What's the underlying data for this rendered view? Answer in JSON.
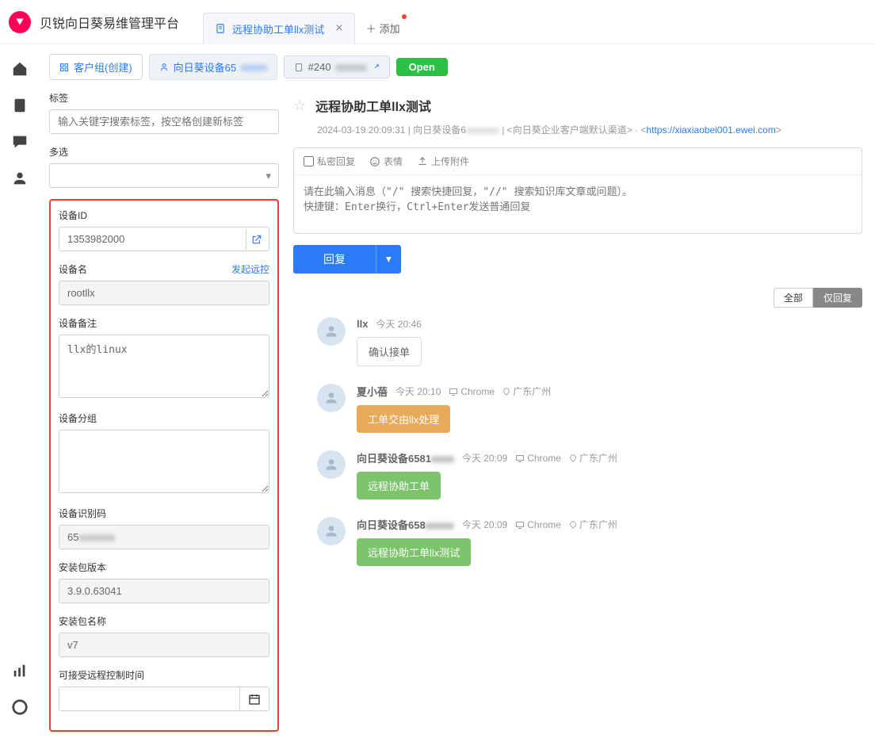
{
  "app": {
    "title": "贝锐向日葵易维管理平台"
  },
  "tabs": {
    "active": "远程协助工单llx测试",
    "add": "添加"
  },
  "breadcrumb": {
    "group": "客户组(创建)",
    "device_prefix": "向日葵设备65",
    "device_blur": "xxxxx",
    "ticket_prefix": "#240",
    "ticket_blur": "xxxxxx",
    "status": "Open"
  },
  "left": {
    "tags_label": "标签",
    "tags_placeholder": "输入关键字搜索标签，按空格创建新标签",
    "multi_label": "多选",
    "device_id_label": "设备ID",
    "device_id": "1353982000",
    "device_name_label": "设备名",
    "remote_link": "发起远控",
    "device_name": "rootllx",
    "device_note_label": "设备备注",
    "device_note": "llx的linux",
    "device_group_label": "设备分组",
    "device_group": "",
    "device_code_label": "设备识别码",
    "device_code_prefix": "65",
    "device_code_blur": "xxxxxxx",
    "pkg_version_label": "安装包版本",
    "pkg_version": "3.9.0.63041",
    "pkg_name_label": "安装包名称",
    "pkg_name": "v7",
    "remote_time_label": "可接受远程控制时间",
    "remote_time": ""
  },
  "ticket": {
    "title": "远程协助工单llx测试",
    "meta_time": "2024-03-19 20:09:31",
    "meta_device_prefix": "向日葵设备6",
    "meta_device_blur": "xxxxxxx",
    "meta_channel": "<向日葵企业客户端默认渠道>",
    "meta_url": "https://xiaxiaobei001.ewei.com",
    "reply_private": "私密回复",
    "reply_emoji": "表情",
    "reply_upload": "上传附件",
    "reply_placeholder": "请在此输入消息（\"/\" 搜索快捷回复，\"//\" 搜索知识库文章或问题）。\n快捷键：Enter换行，Ctrl+Enter发送普通回复",
    "reply_btn": "回复",
    "filter_all": "全部",
    "filter_reply": "仅回复"
  },
  "messages": [
    {
      "name": "llx",
      "time": "今天 20:46",
      "browser": "",
      "location": "",
      "bubble": "确认接单",
      "style": "white"
    },
    {
      "name": "夏小蓓",
      "time": "今天 20:10",
      "browser": "Chrome",
      "location": "广东广州",
      "bubble": "工单交由llx处理",
      "style": "orange"
    },
    {
      "name_prefix": "向日葵设备6581",
      "name_blur": "xxxx",
      "time": "今天 20:09",
      "browser": "Chrome",
      "location": "广东广州",
      "bubble": "远程协助工单",
      "style": "green"
    },
    {
      "name_prefix": "向日葵设备658",
      "name_blur": "xxxxx",
      "time": "今天 20:09",
      "browser": "Chrome",
      "location": "广东广州",
      "bubble": "远程协助工单llx测试",
      "style": "green"
    }
  ]
}
